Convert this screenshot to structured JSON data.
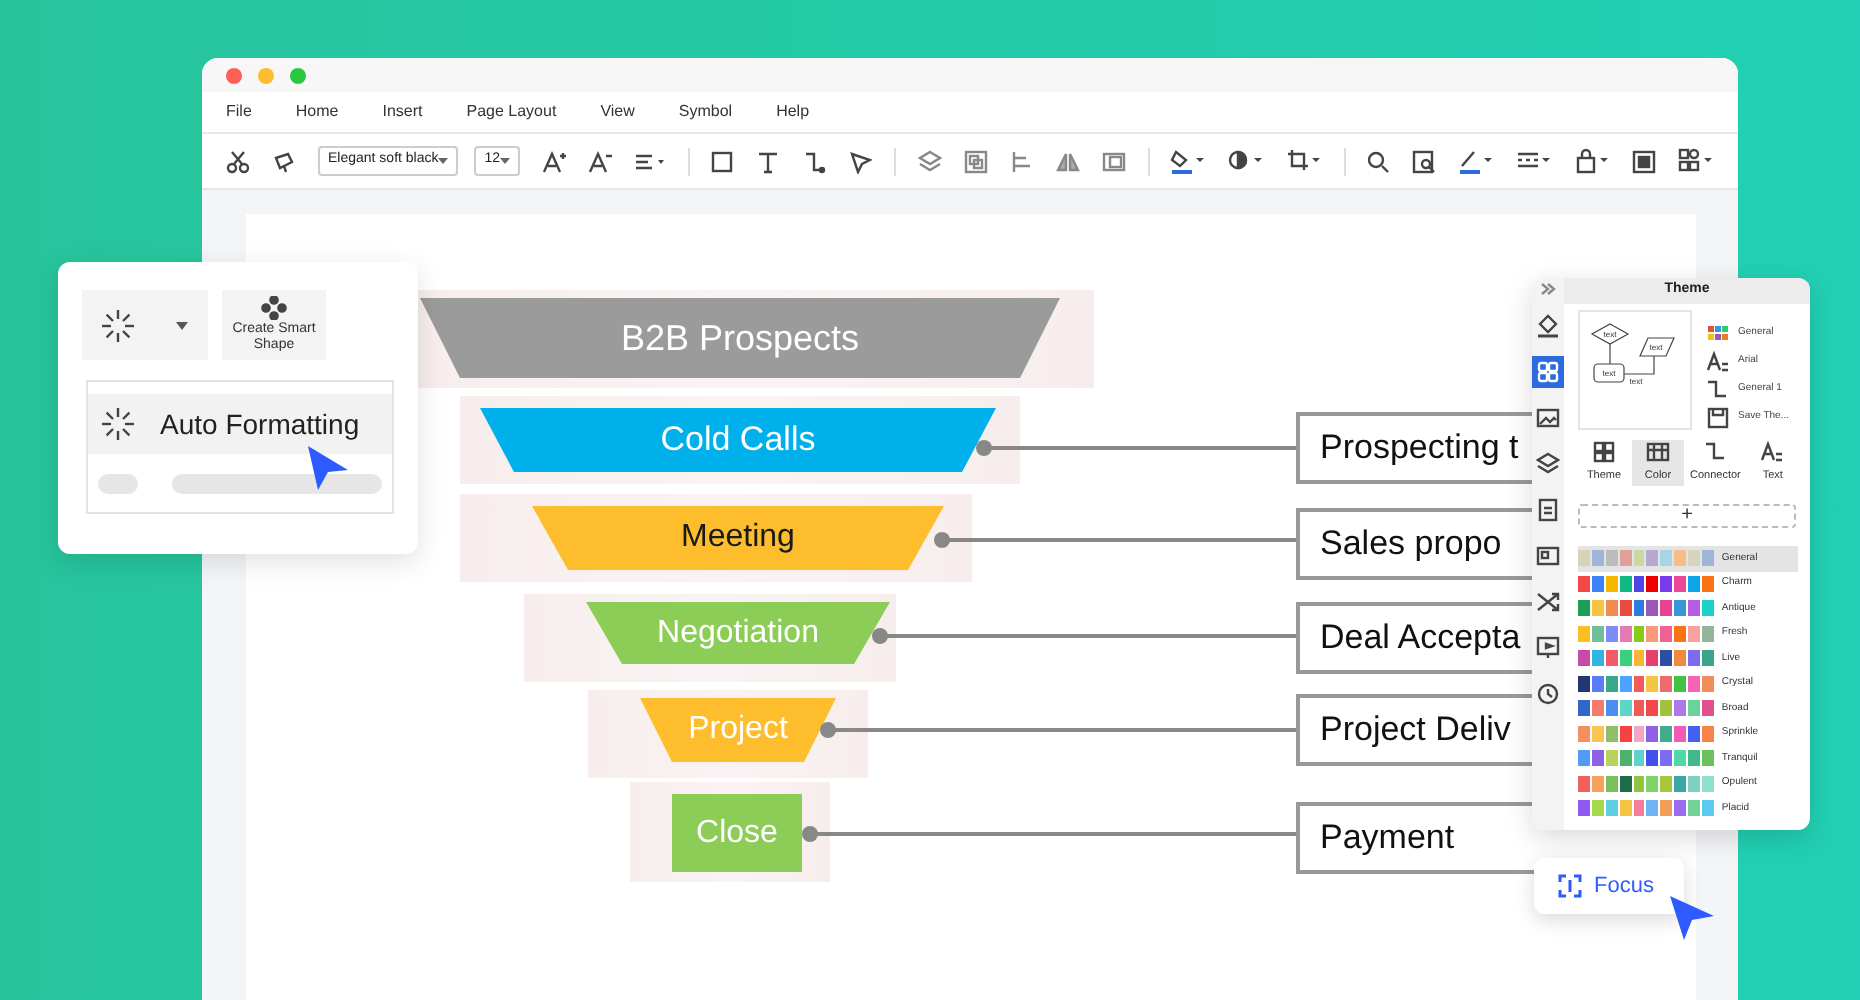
{
  "window": {
    "menu": [
      "File",
      "Home",
      "Insert",
      "Page Layout",
      "View",
      "Symbol",
      "Help"
    ]
  },
  "toolbar": {
    "font": "Elegant soft black",
    "size": "12"
  },
  "funnel": [
    {
      "label": "B2B  Prospects",
      "color": "#9b9b9b",
      "dark_text": false
    },
    {
      "label": "Cold Calls",
      "color": "#00b0ea",
      "dark_text": false
    },
    {
      "label": "Meeting",
      "color": "#fdbd2c",
      "dark_text": true
    },
    {
      "label": "Negotiation",
      "color": "#8ccd57",
      "dark_text": false
    },
    {
      "label": "Project",
      "color": "#fdbd2c",
      "dark_text": false
    },
    {
      "label": "Close",
      "color": "#8ccd57",
      "dark_text": false
    }
  ],
  "outcomes": [
    "Prospecting t",
    "Sales propo",
    "Deal Accepta",
    "Project Deliv",
    "Payment"
  ],
  "format_card": {
    "smart_shape": "Create Smart Shape",
    "auto_formatting": "Auto Formatting"
  },
  "theme_panel": {
    "title": "Theme",
    "side_tabs": [
      {
        "selected": false
      },
      {
        "selected": true
      },
      {
        "selected": false
      },
      {
        "selected": false
      },
      {
        "selected": false
      },
      {
        "selected": false
      },
      {
        "selected": false
      },
      {
        "selected": false
      },
      {
        "selected": false
      }
    ],
    "preview_labels": [
      "text",
      "text",
      "text",
      "text"
    ],
    "options": [
      "General",
      "Arial",
      "General 1",
      "Save The..."
    ],
    "tabs": [
      {
        "label": "Theme",
        "selected": false
      },
      {
        "label": "Color",
        "selected": true
      },
      {
        "label": "Connector",
        "selected": false
      },
      {
        "label": "Text",
        "selected": false
      }
    ],
    "add": "+",
    "palettes": [
      {
        "name": "General",
        "selected": true,
        "swatches": [
          {
            "color": "#d6d3b8"
          },
          {
            "color": "#9fb6d8"
          },
          {
            "color": "#bcbcbc"
          },
          {
            "color": "#e0a09a"
          },
          {
            "color": "#c9d9a3"
          },
          {
            "color": "#b5a8d2"
          },
          {
            "color": "#a8d4e6"
          },
          {
            "color": "#f6bd8a"
          },
          {
            "color": "#d8d4bb"
          },
          {
            "color": "#9fb5d7"
          }
        ]
      },
      {
        "name": "Charm",
        "selected": false,
        "swatches": [
          {
            "color": "#f04848"
          },
          {
            "color": "#3b82f6"
          },
          {
            "color": "#f5b800"
          },
          {
            "color": "#10b981"
          },
          {
            "color": "#4f46e5"
          },
          {
            "color": "#ef0000"
          },
          {
            "color": "#7c3aed"
          },
          {
            "color": "#ec4899"
          },
          {
            "color": "#0ea5e9"
          },
          {
            "color": "#f97316"
          }
        ]
      },
      {
        "name": "Antique",
        "selected": false,
        "swatches": [
          {
            "color": "#1f9d55"
          },
          {
            "color": "#f6c343"
          },
          {
            "color": "#f28b50"
          },
          {
            "color": "#e74c3c"
          },
          {
            "color": "#2d7be5"
          },
          {
            "color": "#9b59b6"
          },
          {
            "color": "#e84393"
          },
          {
            "color": "#3498db"
          },
          {
            "color": "#b55de8"
          },
          {
            "color": "#1dd3c7"
          }
        ]
      },
      {
        "name": "Fresh",
        "selected": false,
        "swatches": [
          {
            "color": "#fbbf24"
          },
          {
            "color": "#6fbf9a"
          },
          {
            "color": "#7c8cf8"
          },
          {
            "color": "#e57ab5"
          },
          {
            "color": "#84cc16"
          },
          {
            "color": "#f79a7a"
          },
          {
            "color": "#f06292"
          },
          {
            "color": "#f97316"
          },
          {
            "color": "#f7a1a1"
          },
          {
            "color": "#93b59a"
          }
        ]
      },
      {
        "name": "Live",
        "selected": false,
        "swatches": [
          {
            "color": "#c74aa6"
          },
          {
            "color": "#2fb6e0"
          },
          {
            "color": "#f05a6a"
          },
          {
            "color": "#3ccf7e"
          },
          {
            "color": "#f7b733"
          },
          {
            "color": "#e63e6d"
          },
          {
            "color": "#2c4fa6"
          },
          {
            "color": "#f08a3c"
          },
          {
            "color": "#7d6cf2"
          },
          {
            "color": "#3aa58c"
          }
        ]
      },
      {
        "name": "Crystal",
        "selected": false,
        "swatches": [
          {
            "color": "#23366f"
          },
          {
            "color": "#5b7cfa"
          },
          {
            "color": "#3aa88f"
          },
          {
            "color": "#4da3ff"
          },
          {
            "color": "#f35a5a"
          },
          {
            "color": "#f5c542"
          },
          {
            "color": "#f06b6b"
          },
          {
            "color": "#41c441"
          },
          {
            "color": "#f564b3"
          },
          {
            "color": "#f38c5d"
          }
        ]
      },
      {
        "name": "Broad",
        "selected": false,
        "swatches": [
          {
            "color": "#3266c8"
          },
          {
            "color": "#f37b6b"
          },
          {
            "color": "#4a8ef0"
          },
          {
            "color": "#5bd6c8"
          },
          {
            "color": "#f25a5a"
          },
          {
            "color": "#f4474a"
          },
          {
            "color": "#a1c23a"
          },
          {
            "color": "#ad79e8"
          },
          {
            "color": "#6ad29b"
          },
          {
            "color": "#e24f8f"
          }
        ]
      },
      {
        "name": "Sprinkle",
        "selected": false,
        "swatches": [
          {
            "color": "#f68e5f"
          },
          {
            "color": "#f9c74f"
          },
          {
            "color": "#90be6d"
          },
          {
            "color": "#f94144"
          },
          {
            "color": "#f3a6c8"
          },
          {
            "color": "#8f5fe8"
          },
          {
            "color": "#43aa8b"
          },
          {
            "color": "#f15bb5"
          },
          {
            "color": "#4361ee"
          },
          {
            "color": "#f9844a"
          }
        ]
      },
      {
        "name": "Tranquil",
        "selected": false,
        "swatches": [
          {
            "color": "#4f9cf5"
          },
          {
            "color": "#8d60e8"
          },
          {
            "color": "#b8d35b"
          },
          {
            "color": "#4bb36b"
          },
          {
            "color": "#5fd3c7"
          },
          {
            "color": "#4150e8"
          },
          {
            "color": "#7c6cf2"
          },
          {
            "color": "#4ed9a7"
          },
          {
            "color": "#3fb88c"
          },
          {
            "color": "#6bc15a"
          }
        ]
      },
      {
        "name": "Opulent",
        "selected": false,
        "swatches": [
          {
            "color": "#f25f5c"
          },
          {
            "color": "#f5a25d"
          },
          {
            "color": "#79c05a"
          },
          {
            "color": "#1e6b4a"
          },
          {
            "color": "#8dc63f"
          },
          {
            "color": "#7fd36a"
          },
          {
            "color": "#a8c83c"
          },
          {
            "color": "#3aa8a8"
          },
          {
            "color": "#7cd3c0"
          },
          {
            "color": "#8ee0d0"
          }
        ]
      },
      {
        "name": "Placid",
        "selected": false,
        "swatches": [
          {
            "color": "#8e5cf0"
          },
          {
            "color": "#a6d84b"
          },
          {
            "color": "#5fd0e0"
          },
          {
            "color": "#f4c542"
          },
          {
            "color": "#f57c9b"
          },
          {
            "color": "#6fb4f5"
          },
          {
            "color": "#f29d5b"
          },
          {
            "color": "#9a6cf0"
          },
          {
            "color": "#71d39a"
          },
          {
            "color": "#5cc9f0"
          }
        ]
      }
    ]
  },
  "focus_button": "Focus"
}
